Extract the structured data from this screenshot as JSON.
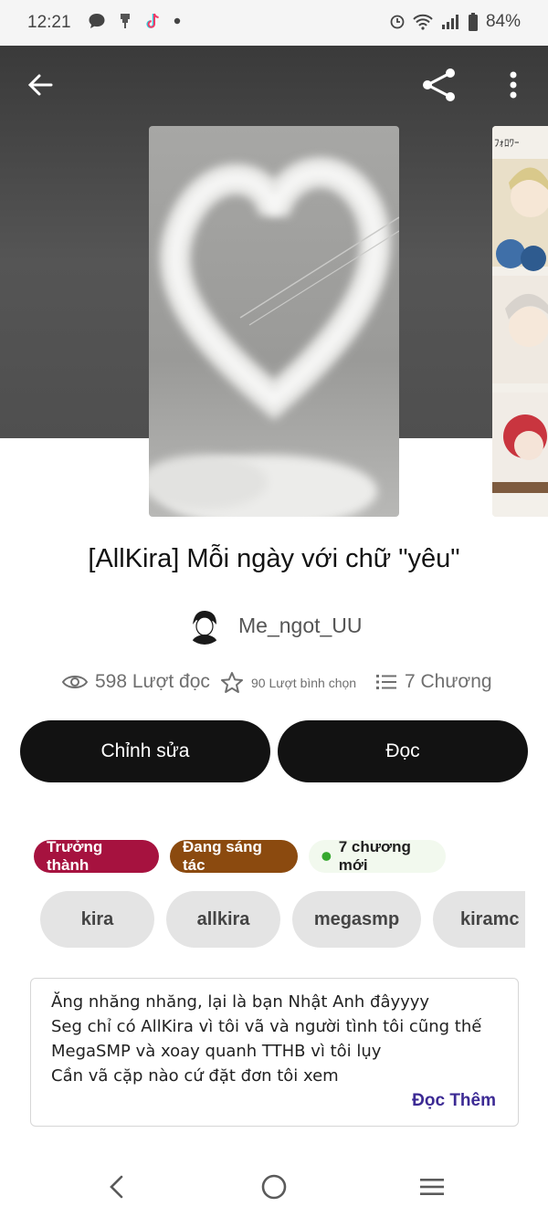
{
  "status_bar": {
    "time": "12:21",
    "battery": "84%",
    "left_icons": [
      "chat-bubble-icon",
      "usb-icon",
      "tiktok-icon",
      "dot-icon"
    ],
    "right_icons": [
      "alarm-icon",
      "wifi-icon",
      "signal-icon",
      "battery-icon"
    ]
  },
  "header": {
    "back_icon": "arrow-left-icon",
    "share_icon": "share-icon",
    "more_icon": "more-vertical-icon"
  },
  "story": {
    "title": "[AllKira] Mỗi ngày với chữ \"yêu\"",
    "author": "Me_ngot_UU",
    "reads": "598 Lượt đọc",
    "votes": "90 Lượt bình chọn",
    "chapters": "7 Chương"
  },
  "actions": {
    "edit_label": "Chỉnh sửa",
    "read_label": "Đọc"
  },
  "badges": [
    {
      "label": "Trưởng thành",
      "bg": "#a6123f",
      "color": "#ffffff"
    },
    {
      "label": "Đang sáng tác",
      "bg": "#8b4a0f",
      "color": "#ffffff"
    },
    {
      "label": "7 chương mới",
      "bg": "#f2f9ee",
      "color": "#1f1f1f",
      "dot_color": "#36a82e"
    }
  ],
  "tags": [
    "kira",
    "allkira",
    "megasmp",
    "kiramc"
  ],
  "description": {
    "lines": [
      "Ăng nhăng nhăng, lại là bạn Nhật Anh đâyyyy",
      "Seg chỉ có AllKira vì tôi vã và người tình tôi cũng thế",
      "MegaSMP và xoay quanh TTHB vì tôi lụy",
      "Cần vã cặp nào cứ đặt đơn tôi xem"
    ],
    "read_more": "Đọc Thêm"
  },
  "nav": {
    "back_icon": "chevron-left-icon",
    "home_icon": "home-circle-icon",
    "recents_icon": "menu-lines-icon"
  }
}
